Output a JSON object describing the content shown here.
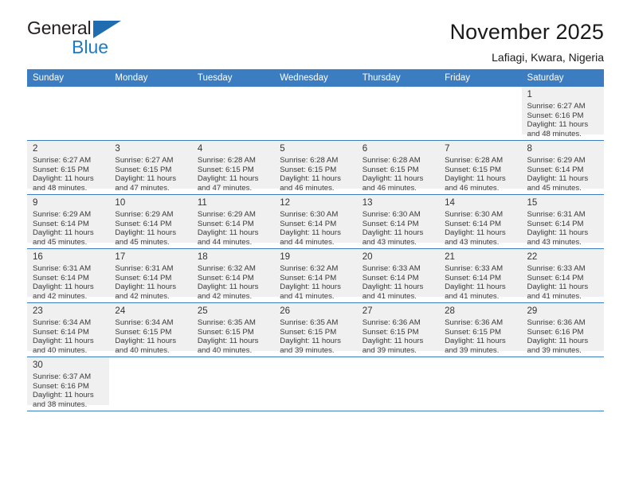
{
  "brand": {
    "name_part1": "General",
    "name_part2": "Blue",
    "flag_icon": "triangle-flag-icon",
    "accent_color": "#1f7bc1"
  },
  "header": {
    "title": "November 2025",
    "location": "Lafiagi, Kwara, Nigeria"
  },
  "calendar": {
    "header_color": "#3b7dc0",
    "weekdays": [
      "Sunday",
      "Monday",
      "Tuesday",
      "Wednesday",
      "Thursday",
      "Friday",
      "Saturday"
    ],
    "weeks": [
      [
        {
          "day": "",
          "sunrise": "",
          "sunset": "",
          "daylight1": "",
          "daylight2": "",
          "empty": true
        },
        {
          "day": "",
          "sunrise": "",
          "sunset": "",
          "daylight1": "",
          "daylight2": "",
          "empty": true
        },
        {
          "day": "",
          "sunrise": "",
          "sunset": "",
          "daylight1": "",
          "daylight2": "",
          "empty": true
        },
        {
          "day": "",
          "sunrise": "",
          "sunset": "",
          "daylight1": "",
          "daylight2": "",
          "empty": true
        },
        {
          "day": "",
          "sunrise": "",
          "sunset": "",
          "daylight1": "",
          "daylight2": "",
          "empty": true
        },
        {
          "day": "",
          "sunrise": "",
          "sunset": "",
          "daylight1": "",
          "daylight2": "",
          "empty": true
        },
        {
          "day": "1",
          "sunrise": "Sunrise: 6:27 AM",
          "sunset": "Sunset: 6:16 PM",
          "daylight1": "Daylight: 11 hours",
          "daylight2": "and 48 minutes.",
          "empty": false
        }
      ],
      [
        {
          "day": "2",
          "sunrise": "Sunrise: 6:27 AM",
          "sunset": "Sunset: 6:15 PM",
          "daylight1": "Daylight: 11 hours",
          "daylight2": "and 48 minutes.",
          "empty": false
        },
        {
          "day": "3",
          "sunrise": "Sunrise: 6:27 AM",
          "sunset": "Sunset: 6:15 PM",
          "daylight1": "Daylight: 11 hours",
          "daylight2": "and 47 minutes.",
          "empty": false
        },
        {
          "day": "4",
          "sunrise": "Sunrise: 6:28 AM",
          "sunset": "Sunset: 6:15 PM",
          "daylight1": "Daylight: 11 hours",
          "daylight2": "and 47 minutes.",
          "empty": false
        },
        {
          "day": "5",
          "sunrise": "Sunrise: 6:28 AM",
          "sunset": "Sunset: 6:15 PM",
          "daylight1": "Daylight: 11 hours",
          "daylight2": "and 46 minutes.",
          "empty": false
        },
        {
          "day": "6",
          "sunrise": "Sunrise: 6:28 AM",
          "sunset": "Sunset: 6:15 PM",
          "daylight1": "Daylight: 11 hours",
          "daylight2": "and 46 minutes.",
          "empty": false
        },
        {
          "day": "7",
          "sunrise": "Sunrise: 6:28 AM",
          "sunset": "Sunset: 6:15 PM",
          "daylight1": "Daylight: 11 hours",
          "daylight2": "and 46 minutes.",
          "empty": false
        },
        {
          "day": "8",
          "sunrise": "Sunrise: 6:29 AM",
          "sunset": "Sunset: 6:14 PM",
          "daylight1": "Daylight: 11 hours",
          "daylight2": "and 45 minutes.",
          "empty": false
        }
      ],
      [
        {
          "day": "9",
          "sunrise": "Sunrise: 6:29 AM",
          "sunset": "Sunset: 6:14 PM",
          "daylight1": "Daylight: 11 hours",
          "daylight2": "and 45 minutes.",
          "empty": false
        },
        {
          "day": "10",
          "sunrise": "Sunrise: 6:29 AM",
          "sunset": "Sunset: 6:14 PM",
          "daylight1": "Daylight: 11 hours",
          "daylight2": "and 45 minutes.",
          "empty": false
        },
        {
          "day": "11",
          "sunrise": "Sunrise: 6:29 AM",
          "sunset": "Sunset: 6:14 PM",
          "daylight1": "Daylight: 11 hours",
          "daylight2": "and 44 minutes.",
          "empty": false
        },
        {
          "day": "12",
          "sunrise": "Sunrise: 6:30 AM",
          "sunset": "Sunset: 6:14 PM",
          "daylight1": "Daylight: 11 hours",
          "daylight2": "and 44 minutes.",
          "empty": false
        },
        {
          "day": "13",
          "sunrise": "Sunrise: 6:30 AM",
          "sunset": "Sunset: 6:14 PM",
          "daylight1": "Daylight: 11 hours",
          "daylight2": "and 43 minutes.",
          "empty": false
        },
        {
          "day": "14",
          "sunrise": "Sunrise: 6:30 AM",
          "sunset": "Sunset: 6:14 PM",
          "daylight1": "Daylight: 11 hours",
          "daylight2": "and 43 minutes.",
          "empty": false
        },
        {
          "day": "15",
          "sunrise": "Sunrise: 6:31 AM",
          "sunset": "Sunset: 6:14 PM",
          "daylight1": "Daylight: 11 hours",
          "daylight2": "and 43 minutes.",
          "empty": false
        }
      ],
      [
        {
          "day": "16",
          "sunrise": "Sunrise: 6:31 AM",
          "sunset": "Sunset: 6:14 PM",
          "daylight1": "Daylight: 11 hours",
          "daylight2": "and 42 minutes.",
          "empty": false
        },
        {
          "day": "17",
          "sunrise": "Sunrise: 6:31 AM",
          "sunset": "Sunset: 6:14 PM",
          "daylight1": "Daylight: 11 hours",
          "daylight2": "and 42 minutes.",
          "empty": false
        },
        {
          "day": "18",
          "sunrise": "Sunrise: 6:32 AM",
          "sunset": "Sunset: 6:14 PM",
          "daylight1": "Daylight: 11 hours",
          "daylight2": "and 42 minutes.",
          "empty": false
        },
        {
          "day": "19",
          "sunrise": "Sunrise: 6:32 AM",
          "sunset": "Sunset: 6:14 PM",
          "daylight1": "Daylight: 11 hours",
          "daylight2": "and 41 minutes.",
          "empty": false
        },
        {
          "day": "20",
          "sunrise": "Sunrise: 6:33 AM",
          "sunset": "Sunset: 6:14 PM",
          "daylight1": "Daylight: 11 hours",
          "daylight2": "and 41 minutes.",
          "empty": false
        },
        {
          "day": "21",
          "sunrise": "Sunrise: 6:33 AM",
          "sunset": "Sunset: 6:14 PM",
          "daylight1": "Daylight: 11 hours",
          "daylight2": "and 41 minutes.",
          "empty": false
        },
        {
          "day": "22",
          "sunrise": "Sunrise: 6:33 AM",
          "sunset": "Sunset: 6:14 PM",
          "daylight1": "Daylight: 11 hours",
          "daylight2": "and 41 minutes.",
          "empty": false
        }
      ],
      [
        {
          "day": "23",
          "sunrise": "Sunrise: 6:34 AM",
          "sunset": "Sunset: 6:14 PM",
          "daylight1": "Daylight: 11 hours",
          "daylight2": "and 40 minutes.",
          "empty": false
        },
        {
          "day": "24",
          "sunrise": "Sunrise: 6:34 AM",
          "sunset": "Sunset: 6:15 PM",
          "daylight1": "Daylight: 11 hours",
          "daylight2": "and 40 minutes.",
          "empty": false
        },
        {
          "day": "25",
          "sunrise": "Sunrise: 6:35 AM",
          "sunset": "Sunset: 6:15 PM",
          "daylight1": "Daylight: 11 hours",
          "daylight2": "and 40 minutes.",
          "empty": false
        },
        {
          "day": "26",
          "sunrise": "Sunrise: 6:35 AM",
          "sunset": "Sunset: 6:15 PM",
          "daylight1": "Daylight: 11 hours",
          "daylight2": "and 39 minutes.",
          "empty": false
        },
        {
          "day": "27",
          "sunrise": "Sunrise: 6:36 AM",
          "sunset": "Sunset: 6:15 PM",
          "daylight1": "Daylight: 11 hours",
          "daylight2": "and 39 minutes.",
          "empty": false
        },
        {
          "day": "28",
          "sunrise": "Sunrise: 6:36 AM",
          "sunset": "Sunset: 6:15 PM",
          "daylight1": "Daylight: 11 hours",
          "daylight2": "and 39 minutes.",
          "empty": false
        },
        {
          "day": "29",
          "sunrise": "Sunrise: 6:36 AM",
          "sunset": "Sunset: 6:16 PM",
          "daylight1": "Daylight: 11 hours",
          "daylight2": "and 39 minutes.",
          "empty": false
        }
      ],
      [
        {
          "day": "30",
          "sunrise": "Sunrise: 6:37 AM",
          "sunset": "Sunset: 6:16 PM",
          "daylight1": "Daylight: 11 hours",
          "daylight2": "and 38 minutes.",
          "empty": false
        },
        {
          "day": "",
          "sunrise": "",
          "sunset": "",
          "daylight1": "",
          "daylight2": "",
          "empty": true
        },
        {
          "day": "",
          "sunrise": "",
          "sunset": "",
          "daylight1": "",
          "daylight2": "",
          "empty": true
        },
        {
          "day": "",
          "sunrise": "",
          "sunset": "",
          "daylight1": "",
          "daylight2": "",
          "empty": true
        },
        {
          "day": "",
          "sunrise": "",
          "sunset": "",
          "daylight1": "",
          "daylight2": "",
          "empty": true
        },
        {
          "day": "",
          "sunrise": "",
          "sunset": "",
          "daylight1": "",
          "daylight2": "",
          "empty": true
        },
        {
          "day": "",
          "sunrise": "",
          "sunset": "",
          "daylight1": "",
          "daylight2": "",
          "empty": true
        }
      ]
    ]
  }
}
